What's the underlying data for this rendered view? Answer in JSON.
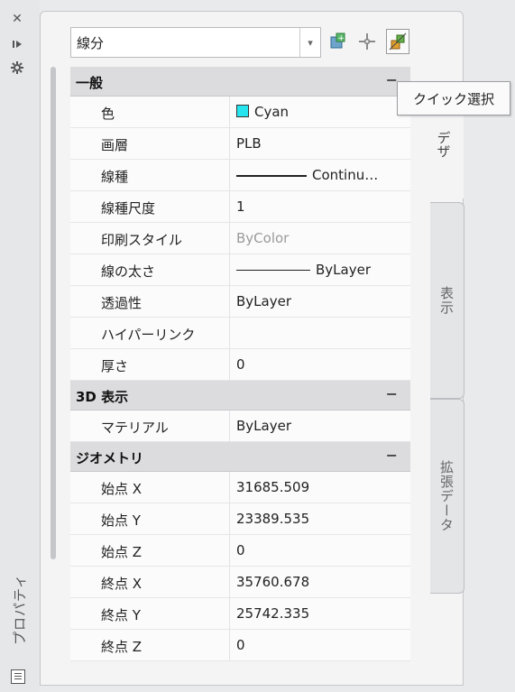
{
  "strip": {
    "title": "プロパティ",
    "close_icon": "close-icon",
    "autohide_icon": "autohide-icon",
    "settings_icon": "settings-icon",
    "menu_icon": "properties-menu-icon"
  },
  "selector": {
    "value": "線分",
    "tools": [
      "toggle-pickadd-icon",
      "select-objects-icon",
      "quick-select-icon"
    ]
  },
  "tooltip": {
    "text": "クイック選択"
  },
  "tabs": [
    {
      "label": "デザイン",
      "visible_label": "デザ",
      "active": true
    },
    {
      "label": "表示",
      "active": false
    },
    {
      "label": "拡張データ",
      "active": false
    }
  ],
  "sections": {
    "general": {
      "title": "一般",
      "toggle": "−",
      "rows": [
        {
          "label": "色",
          "value": "Cyan"
        },
        {
          "label": "画層",
          "value": "PLB"
        },
        {
          "label": "線種",
          "value": "Continu…"
        },
        {
          "label": "線種尺度",
          "value": "1"
        },
        {
          "label": "印刷スタイル",
          "value": "ByColor"
        },
        {
          "label": "線の太さ",
          "value": "ByLayer"
        },
        {
          "label": "透過性",
          "value": "ByLayer"
        },
        {
          "label": "ハイパーリンク",
          "value": ""
        },
        {
          "label": "厚さ",
          "value": "0"
        }
      ]
    },
    "view3d": {
      "title": "3D 表示",
      "toggle": "−",
      "rows": [
        {
          "label": "マテリアル",
          "value": "ByLayer"
        }
      ]
    },
    "geometry": {
      "title": "ジオメトリ",
      "toggle": "−",
      "rows": [
        {
          "label": "始点 X",
          "value": "31685.509"
        },
        {
          "label": "始点 Y",
          "value": "23389.535"
        },
        {
          "label": "始点 Z",
          "value": "0"
        },
        {
          "label": "終点 X",
          "value": "35760.678"
        },
        {
          "label": "終点 Y",
          "value": "25742.335"
        },
        {
          "label": "終点 Z",
          "value": "0"
        }
      ]
    }
  },
  "colors": {
    "cyan_swatch": "#27e5ef",
    "section_bg": "#dcdcde",
    "panel_bg": "#f4f4f5"
  }
}
